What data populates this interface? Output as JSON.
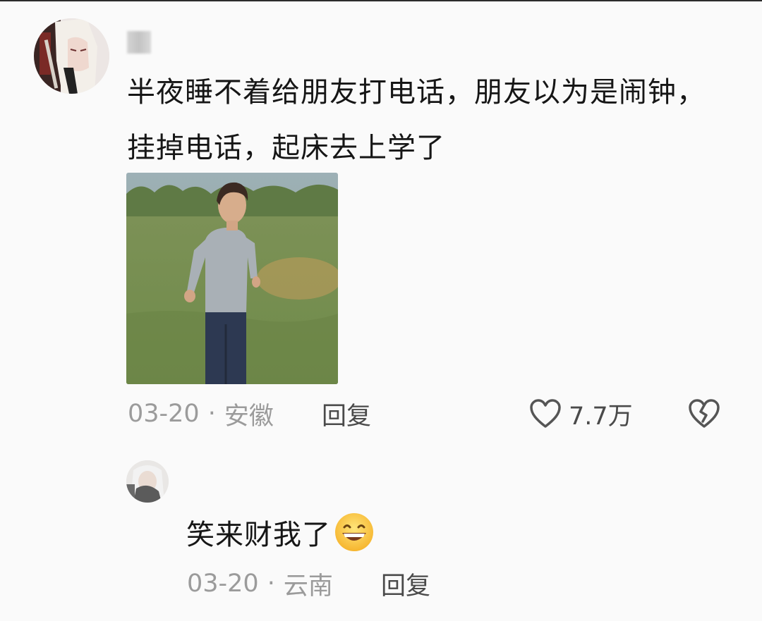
{
  "comment": {
    "text": "半夜睡不着给朋友打电话，朋友以为是闹钟，挂掉电话，起床去上学了",
    "date": "03-20",
    "separator": "·",
    "location": "安徽",
    "reply_label": "回复",
    "like_count": "7.7万",
    "icons": [
      "avatar",
      "image-attachment",
      "heart-icon",
      "broken-heart-icon"
    ]
  },
  "reply": {
    "text": "笑来财我了",
    "emoji": "grinning-face-icon",
    "date": "03-20",
    "separator": "·",
    "location": "云南",
    "reply_label": "回复"
  },
  "colors": {
    "background": "#fafafa",
    "text": "#161616",
    "meta": "#9b9b9b",
    "action": "#4a4a4a"
  }
}
